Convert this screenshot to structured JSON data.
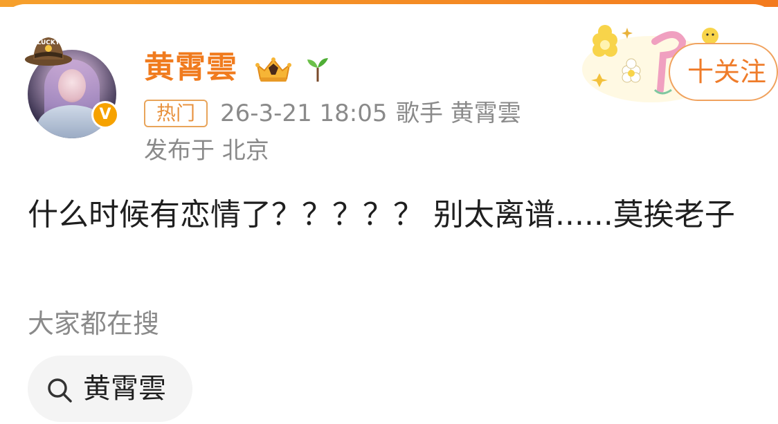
{
  "colors": {
    "accent": "#f07b1e",
    "meta_text": "#8a8a8a",
    "body_text": "#1f1f1f",
    "verified": "#f6a200",
    "chip_bg": "#f4f4f4"
  },
  "author": {
    "name": "黄霄雲",
    "badges": [
      "crown-icon",
      "sprout-icon"
    ],
    "verified_mark": "V",
    "avatar_hat_text": "LUCKY"
  },
  "meta": {
    "tag": "热门",
    "time": "26-3-21 18:05",
    "description": "歌手 黄霄雲",
    "location": "发布于 北京"
  },
  "actions": {
    "follow_label": "十关注"
  },
  "post": {
    "text": "什么时候有恋情了？？？？？ 别太离谱......莫挨老子"
  },
  "search": {
    "heading": "大家都在搜",
    "chips": [
      {
        "label": "黄霄雲",
        "icon": "search-icon"
      }
    ]
  }
}
